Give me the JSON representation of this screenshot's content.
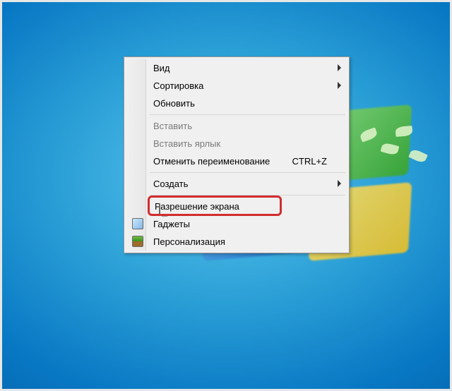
{
  "context_menu": {
    "items": [
      {
        "label": "Вид",
        "has_submenu": true
      },
      {
        "label": "Сортировка",
        "has_submenu": true
      },
      {
        "label": "Обновить"
      },
      {
        "separator": true
      },
      {
        "label": "Вставить",
        "disabled": true
      },
      {
        "label": "Вставить ярлык",
        "disabled": true
      },
      {
        "label": "Отменить переименование",
        "shortcut": "CTRL+Z"
      },
      {
        "separator": true
      },
      {
        "label": "Создать",
        "has_submenu": true
      },
      {
        "separator": true
      },
      {
        "label": "Разрешение экрана",
        "icon": "monitor-icon",
        "highlighted": true
      },
      {
        "label": "Гаджеты",
        "icon": "gadgets-icon"
      },
      {
        "label": "Персонализация",
        "icon": "personalize-icon"
      }
    ]
  }
}
